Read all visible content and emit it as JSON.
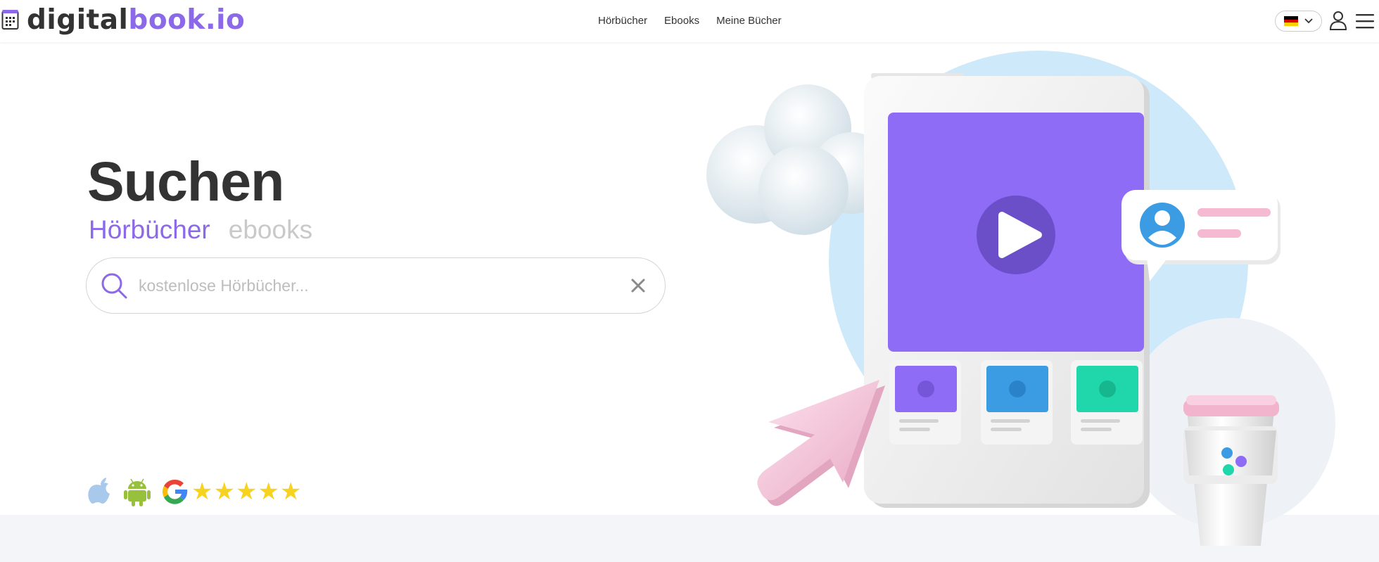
{
  "brand": {
    "name_part1": "digital",
    "name_part2": "book.io"
  },
  "nav": {
    "items": [
      {
        "label": "Hörbücher"
      },
      {
        "label": "Ebooks"
      },
      {
        "label": "Meine Bücher"
      }
    ]
  },
  "header": {
    "language": "DE"
  },
  "hero": {
    "title": "Suchen",
    "tabs": [
      {
        "label": "Hörbücher",
        "active": true
      },
      {
        "label": "ebooks",
        "active": false
      }
    ],
    "search": {
      "placeholder": "kostenlose Hörbücher...",
      "value": ""
    },
    "rating_stars": 5
  },
  "icons": {
    "search": "search-icon",
    "clear": "close-icon",
    "user": "user-icon",
    "menu": "hamburger-icon",
    "apple": "apple-icon",
    "android": "android-icon",
    "google": "google-icon",
    "star": "★"
  },
  "colors": {
    "accent": "#8b69e8",
    "text": "#333333",
    "muted": "#c9c9c9",
    "star": "#f7d21e",
    "footer_band": "#f4f5f9"
  }
}
